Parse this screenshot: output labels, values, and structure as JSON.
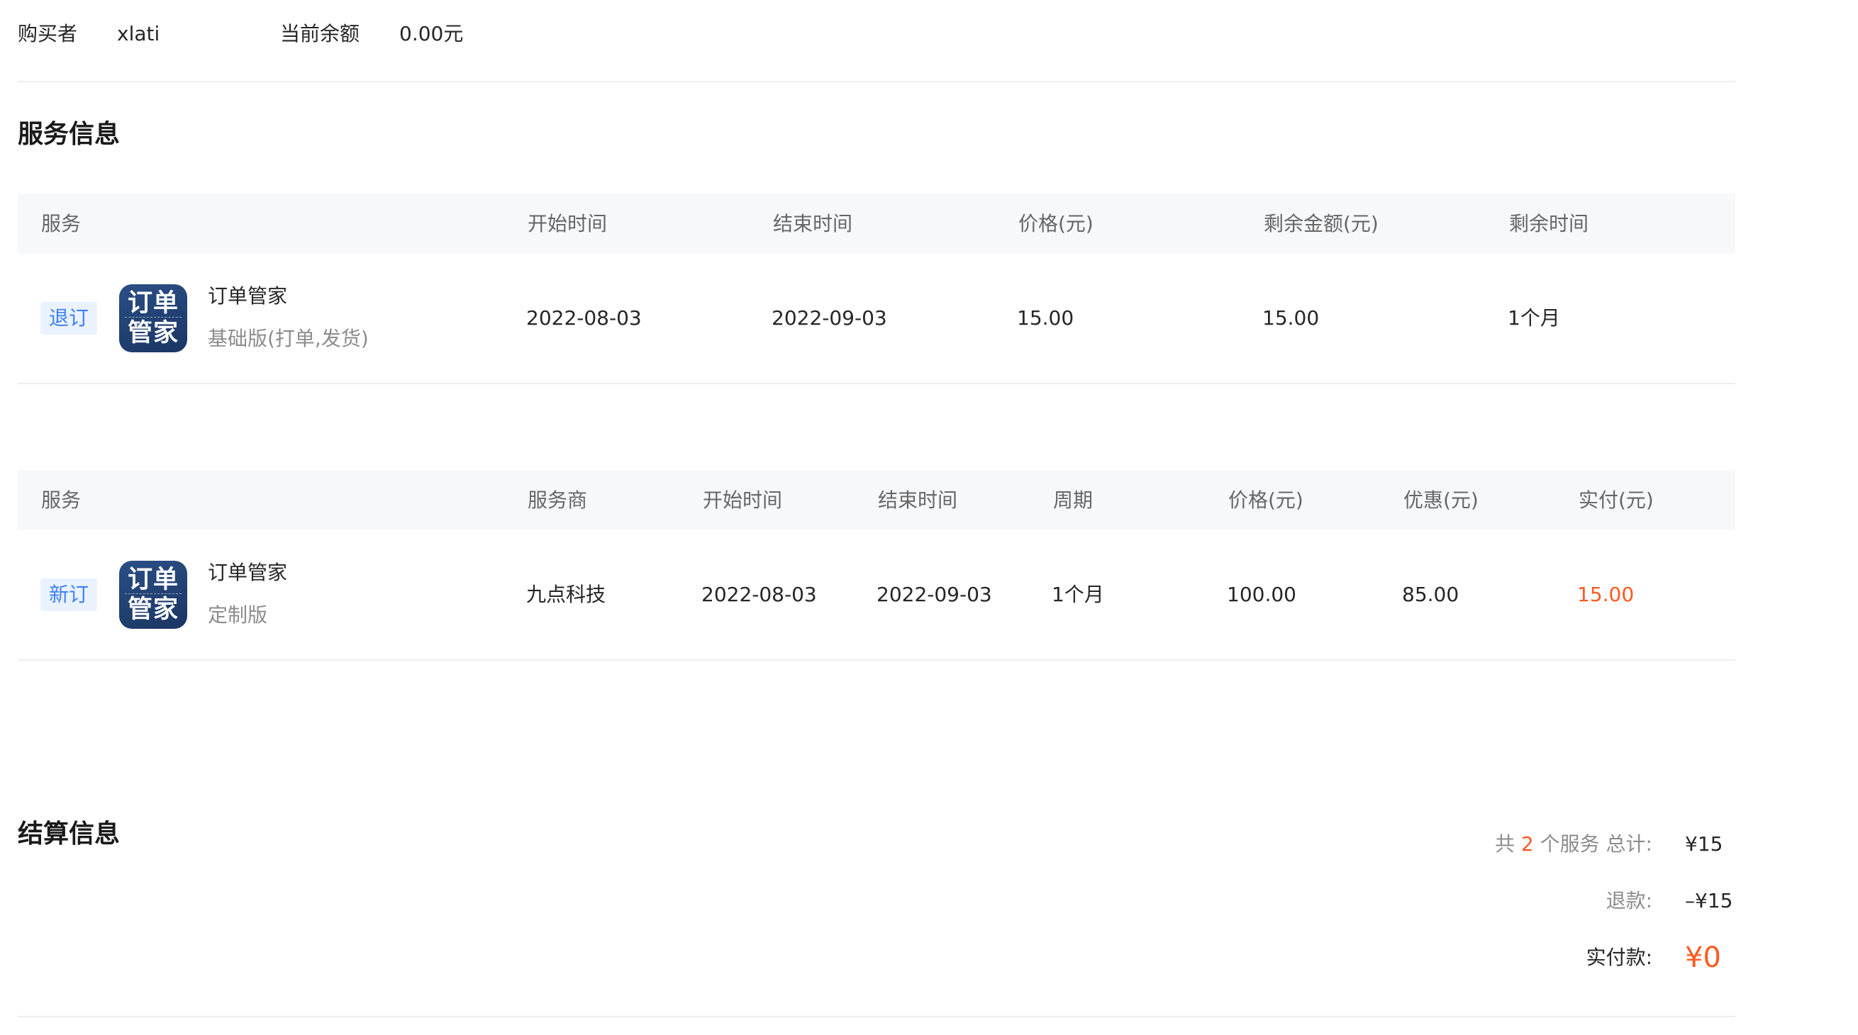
{
  "buyer": {
    "label": "购买者",
    "value": "xlati",
    "balance_label": "当前余额",
    "balance_value": "0.00元"
  },
  "service_info": {
    "title": "服务信息",
    "table1": {
      "headers": [
        "服务",
        "开始时间",
        "结束时间",
        "价格(元)",
        "剩余金额(元)",
        "剩余时间"
      ],
      "row": {
        "tag": "退订",
        "app_icon_text": [
          "订单",
          "管家"
        ],
        "name": "订单管家",
        "edition": "基础版(打单,发货)",
        "start": "2022-08-03",
        "end": "2022-09-03",
        "price": "15.00",
        "remaining_amount": "15.00",
        "remaining_time": "1个月"
      }
    },
    "table2": {
      "headers": [
        "服务",
        "服务商",
        "开始时间",
        "结束时间",
        "周期",
        "价格(元)",
        "优惠(元)",
        "实付(元)"
      ],
      "row": {
        "tag": "新订",
        "app_icon_text": [
          "订单",
          "管家"
        ],
        "name": "订单管家",
        "edition": "定制版",
        "provider": "九点科技",
        "start": "2022-08-03",
        "end": "2022-09-03",
        "period": "1个月",
        "price": "100.00",
        "discount": "85.00",
        "paid": "15.00"
      }
    }
  },
  "settlement": {
    "title": "结算信息",
    "count_prefix": "共",
    "count": "2",
    "count_suffix": "个服务 总计:",
    "total": "¥15",
    "refund_label": "退款:",
    "refund_value": "–¥15",
    "paid_label": "实付款:",
    "paid_value": "¥0"
  },
  "colors": {
    "accent": "#ff5a1f",
    "tag_text": "#3d7fff",
    "tag_bg": "#eaf2ff",
    "header_bg": "#f7f8fa",
    "icon_bg": "#1f3f72"
  }
}
